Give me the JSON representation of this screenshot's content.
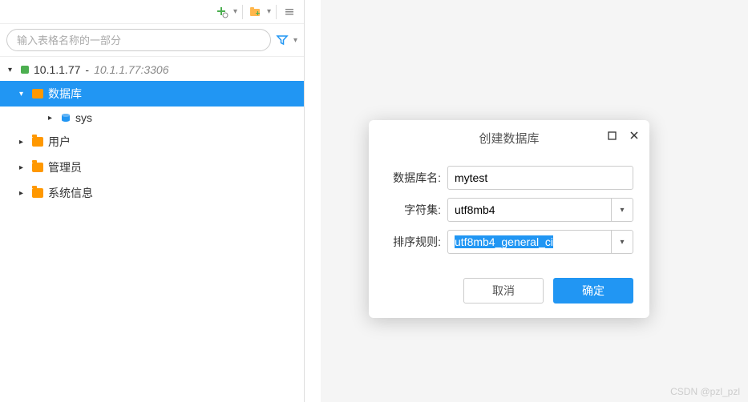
{
  "search": {
    "placeholder": "输入表格名称的一部分"
  },
  "connection": {
    "host": "10.1.1.77",
    "address": "10.1.1.77:3306"
  },
  "tree": {
    "database_label": "数据库",
    "sys_label": "sys",
    "user_label": "用户",
    "admin_label": "管理员",
    "sysinfo_label": "系统信息"
  },
  "dialog": {
    "title": "创建数据库",
    "fields": {
      "name_label": "数据库名:",
      "name_value": "mytest",
      "charset_label": "字符集:",
      "charset_value": "utf8mb4",
      "collation_label": "排序规则:",
      "collation_value": "utf8mb4_general_ci"
    },
    "buttons": {
      "cancel": "取消",
      "ok": "确定"
    }
  },
  "watermark": "CSDN @pzl_pzl"
}
